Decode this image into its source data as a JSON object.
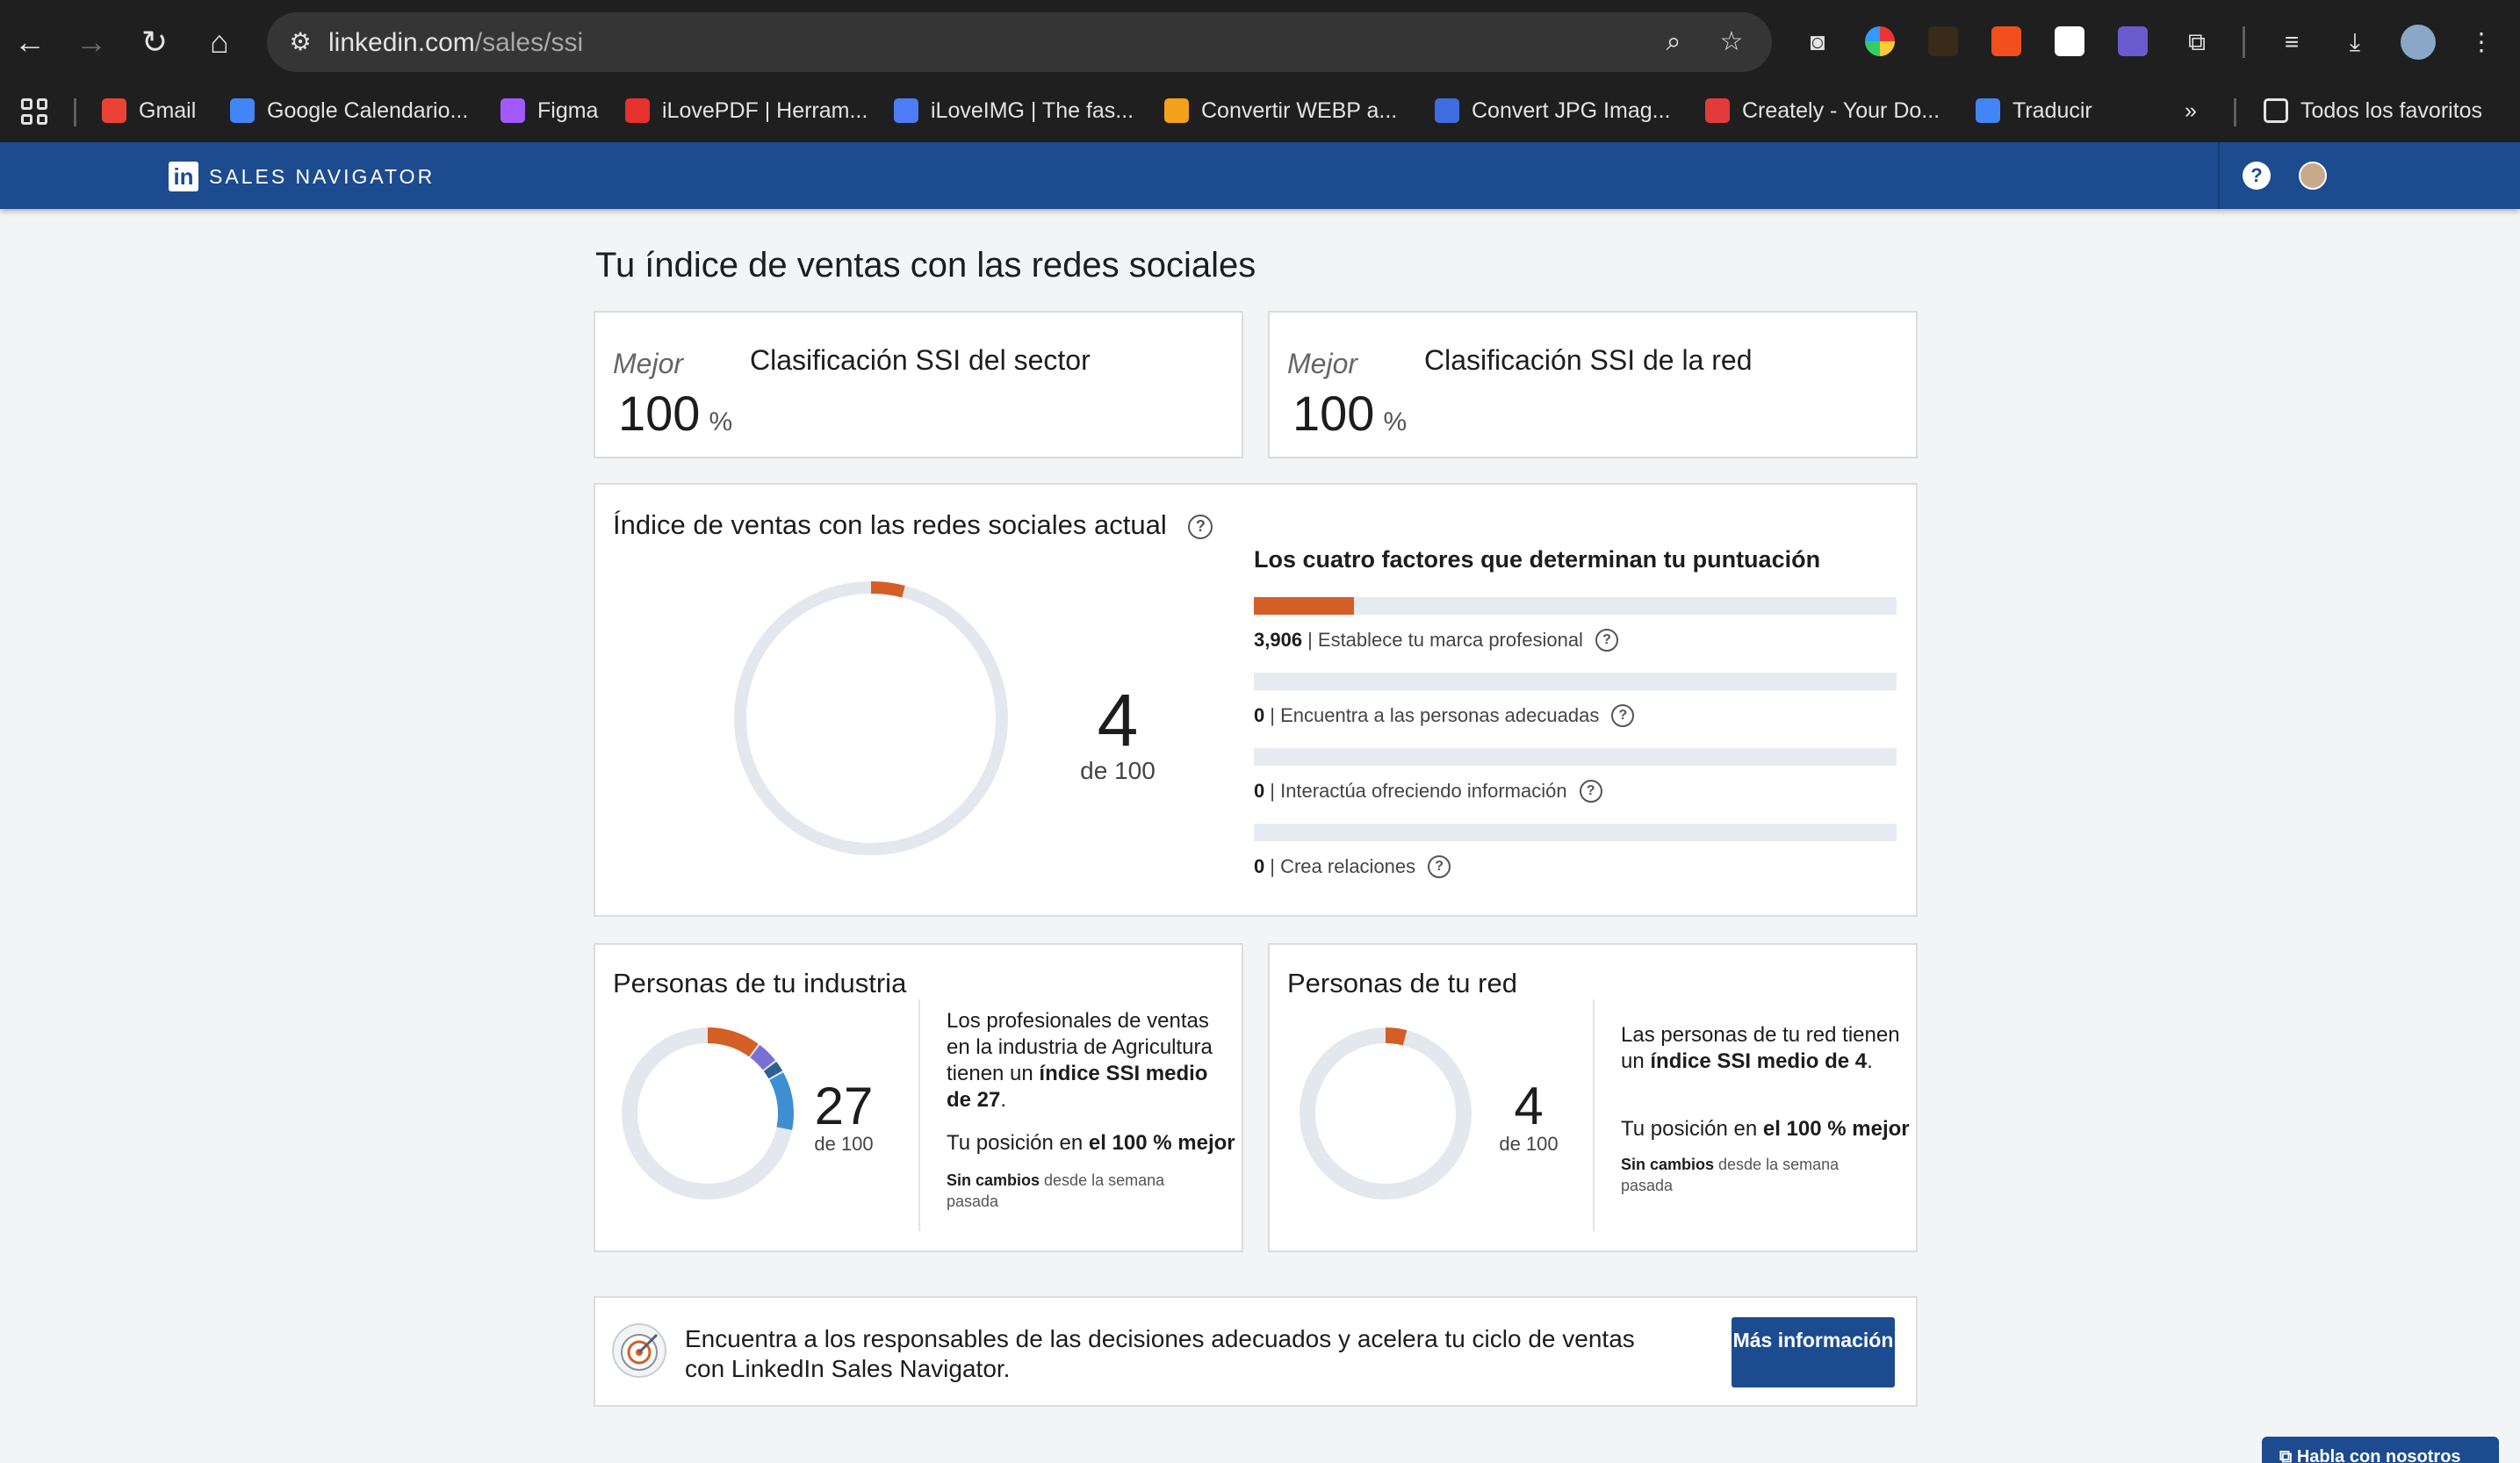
{
  "browser": {
    "url_host": "linkedin.com",
    "url_path": "/sales/ssi",
    "bookmarks": [
      {
        "label": "Gmail",
        "color": "#ea4335"
      },
      {
        "label": "Google Calendario...",
        "color": "#4285f4"
      },
      {
        "label": "Figma",
        "color": "#a259ff"
      },
      {
        "label": "iLovePDF | Herram...",
        "color": "#e5322d"
      },
      {
        "label": "iLoveIMG | The fas...",
        "color": "#4d7cf5"
      },
      {
        "label": "Convertir WEBP a...",
        "color": "#f4a21b"
      },
      {
        "label": "Convert JPG Imag...",
        "color": "#3f6ce0"
      },
      {
        "label": "Creately - Your Do...",
        "color": "#e33b3b"
      },
      {
        "label": "Traducir",
        "color": "#4285f4"
      }
    ],
    "all_bookmarks": "Todos los favoritos"
  },
  "header": {
    "logo": "in",
    "product": "SALES NAVIGATOR",
    "brand_color": "#1d4b8f"
  },
  "page": {
    "title": "Tu índice de ventas con las redes sociales"
  },
  "rankings": [
    {
      "label": "Mejor",
      "value": "100",
      "unit": "%",
      "title": "Clasificación SSI del sector"
    },
    {
      "label": "Mejor",
      "value": "100",
      "unit": "%",
      "title": "Clasificación SSI de la red"
    }
  ],
  "current": {
    "title": "Índice de ventas con las redes sociales actual",
    "score": "4",
    "of": "de 100",
    "score_fraction": 0.04,
    "factors_title": "Los cuatro factores que determinan tu puntuación",
    "accent_color": "#d35f27",
    "factors": [
      {
        "value": "3,906",
        "label": "| Establece tu marca profesional",
        "fraction": 0.156
      },
      {
        "value": "0",
        "label": "| Encuentra a las personas adecuadas",
        "fraction": 0
      },
      {
        "value": "0",
        "label": "| Interactúa ofreciendo información",
        "fraction": 0
      },
      {
        "value": "0",
        "label": "| Crea relaciones",
        "fraction": 0
      }
    ]
  },
  "industry": {
    "title": "Personas de tu industria",
    "score": "27",
    "of": "de 100",
    "desc_pre": "Los profesionales de ventas en la industria de Agricultura tienen un ",
    "desc_bold": "índice SSI medio de 27",
    "desc_post": ".",
    "position_pre": "Tu posición en ",
    "position_bold": "el 100 % mejor",
    "nochange_bold": "Sin cambios",
    "nochange_rest": " desde la semana pasada",
    "segments": [
      {
        "fraction": 0.1,
        "color": "#d35f27"
      },
      {
        "fraction": 0.04,
        "color": "#7b6fd6"
      },
      {
        "fraction": 0.02,
        "color": "#2d5f8f"
      },
      {
        "fraction": 0.11,
        "color": "#3d8fd1"
      }
    ]
  },
  "network": {
    "title": "Personas de tu red",
    "score": "4",
    "of": "de 100",
    "desc_pre": "Las personas de tu red tienen un ",
    "desc_bold": "índice SSI medio de 4",
    "desc_post": ".",
    "position_pre": "Tu posición en ",
    "position_bold": "el 100 % mejor",
    "nochange_bold": "Sin cambios",
    "nochange_rest": " desde la semana pasada",
    "segments": [
      {
        "fraction": 0.04,
        "color": "#d35f27"
      }
    ]
  },
  "promo": {
    "text": "Encuentra a los responsables de las decisiones adecuados y acelera tu ciclo de ventas con LinkedIn Sales Navigator.",
    "button": "Más información"
  },
  "chat": {
    "label": "Habla con nosotros"
  }
}
